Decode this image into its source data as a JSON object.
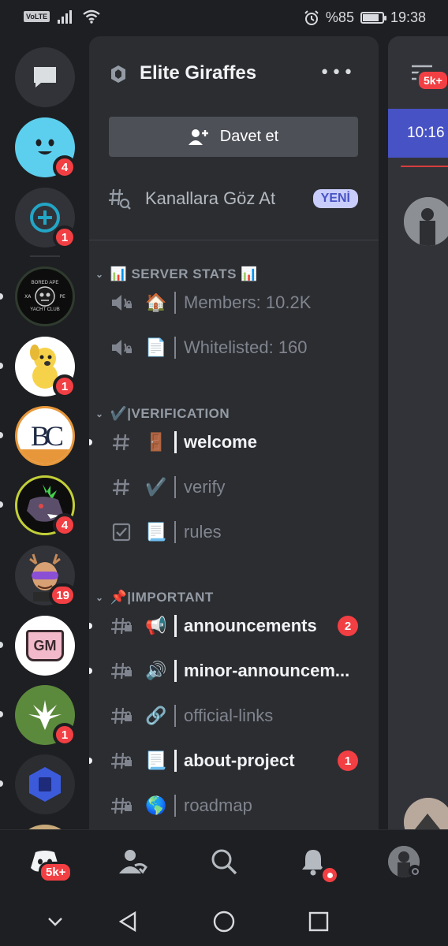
{
  "status_bar": {
    "network_badge": "VoLTE",
    "battery": "%85",
    "battery_level": 0.85,
    "time": "19:38",
    "icons": [
      "signal-icon",
      "wifi-icon",
      "alarm-icon",
      "battery-icon"
    ]
  },
  "server_rail": {
    "direct_messages_icon": "chat-bubble-icon",
    "servers": [
      {
        "name": "smiley-server",
        "badge": "4",
        "color": "#5ccfee"
      },
      {
        "name": "add-server",
        "badge": "1",
        "color": "#1e1f22"
      },
      {
        "name": "bored-ape-yacht-club",
        "badge": "",
        "unread": true
      },
      {
        "name": "yellow-dog-server",
        "badge": "1",
        "unread": true
      },
      {
        "name": "bc-server",
        "badge": "",
        "unread": true
      },
      {
        "name": "punk-wolf-server",
        "badge": "4",
        "unread": true
      },
      {
        "name": "deer-server",
        "badge": "19",
        "unread": false
      },
      {
        "name": "gm-mug-server",
        "badge": "",
        "unread": true
      },
      {
        "name": "leaf-server",
        "badge": "1",
        "unread": true
      },
      {
        "name": "blue-cube-server",
        "badge": "",
        "unread": true
      }
    ],
    "bored_ape_logo_lines": [
      "BORED APE",
      "XA",
      "PE",
      "YACHT CLUB"
    ],
    "bc_logo_text": "BC",
    "gm_logo_text": "GM"
  },
  "guild": {
    "name": "Elite Giraffes",
    "more_label": "•••",
    "invite_label": "Davet et",
    "browse_label": "Kanallara Göz At",
    "new_badge": "YENİ"
  },
  "categories": [
    {
      "title": "📊 SERVER STATS 📊",
      "channels": [
        {
          "type": "voice-locked",
          "emoji": "🏠",
          "name": "Members: 10.2K",
          "unread": false,
          "mention": ""
        },
        {
          "type": "voice-locked",
          "emoji": "📄",
          "name": "Whitelisted: 160",
          "unread": false,
          "mention": ""
        }
      ]
    },
    {
      "title": "✔️|VERIFICATION",
      "channels": [
        {
          "type": "text",
          "emoji": "🚪",
          "name": "welcome",
          "unread": true,
          "mention": ""
        },
        {
          "type": "text",
          "emoji": "✔️",
          "name": "verify",
          "unread": false,
          "mention": ""
        },
        {
          "type": "rules",
          "emoji": "📃",
          "name": "rules",
          "unread": false,
          "mention": ""
        }
      ]
    },
    {
      "title": "📌|IMPORTANT",
      "channels": [
        {
          "type": "text-locked",
          "emoji": "📢",
          "name": "announcements",
          "unread": true,
          "mention": "2"
        },
        {
          "type": "text-locked",
          "emoji": "🔊",
          "name": "minor-announcem...",
          "unread": true,
          "mention": ""
        },
        {
          "type": "text-locked",
          "emoji": "🔗",
          "name": "official-links",
          "unread": false,
          "mention": ""
        },
        {
          "type": "text-locked",
          "emoji": "📃",
          "name": "about-project",
          "unread": true,
          "mention": "1"
        },
        {
          "type": "text-locked",
          "emoji": "🌎",
          "name": "roadmap",
          "unread": false,
          "mention": ""
        }
      ]
    }
  ],
  "peek": {
    "threads_badge": "5k+",
    "message_time": "10:16"
  },
  "bottom_nav": {
    "home_badge": "5k+",
    "items": [
      "home-icon",
      "friends-icon",
      "search-icon",
      "notifications-icon",
      "profile-avatar"
    ]
  },
  "system_nav": [
    "chevron-down-icon",
    "back-icon",
    "home-circle-icon",
    "recents-icon"
  ],
  "colors": {
    "accent": "#4752c4",
    "danger": "#f23f43",
    "rail_bg": "#1e1f22",
    "panel_bg": "#2b2d31"
  }
}
